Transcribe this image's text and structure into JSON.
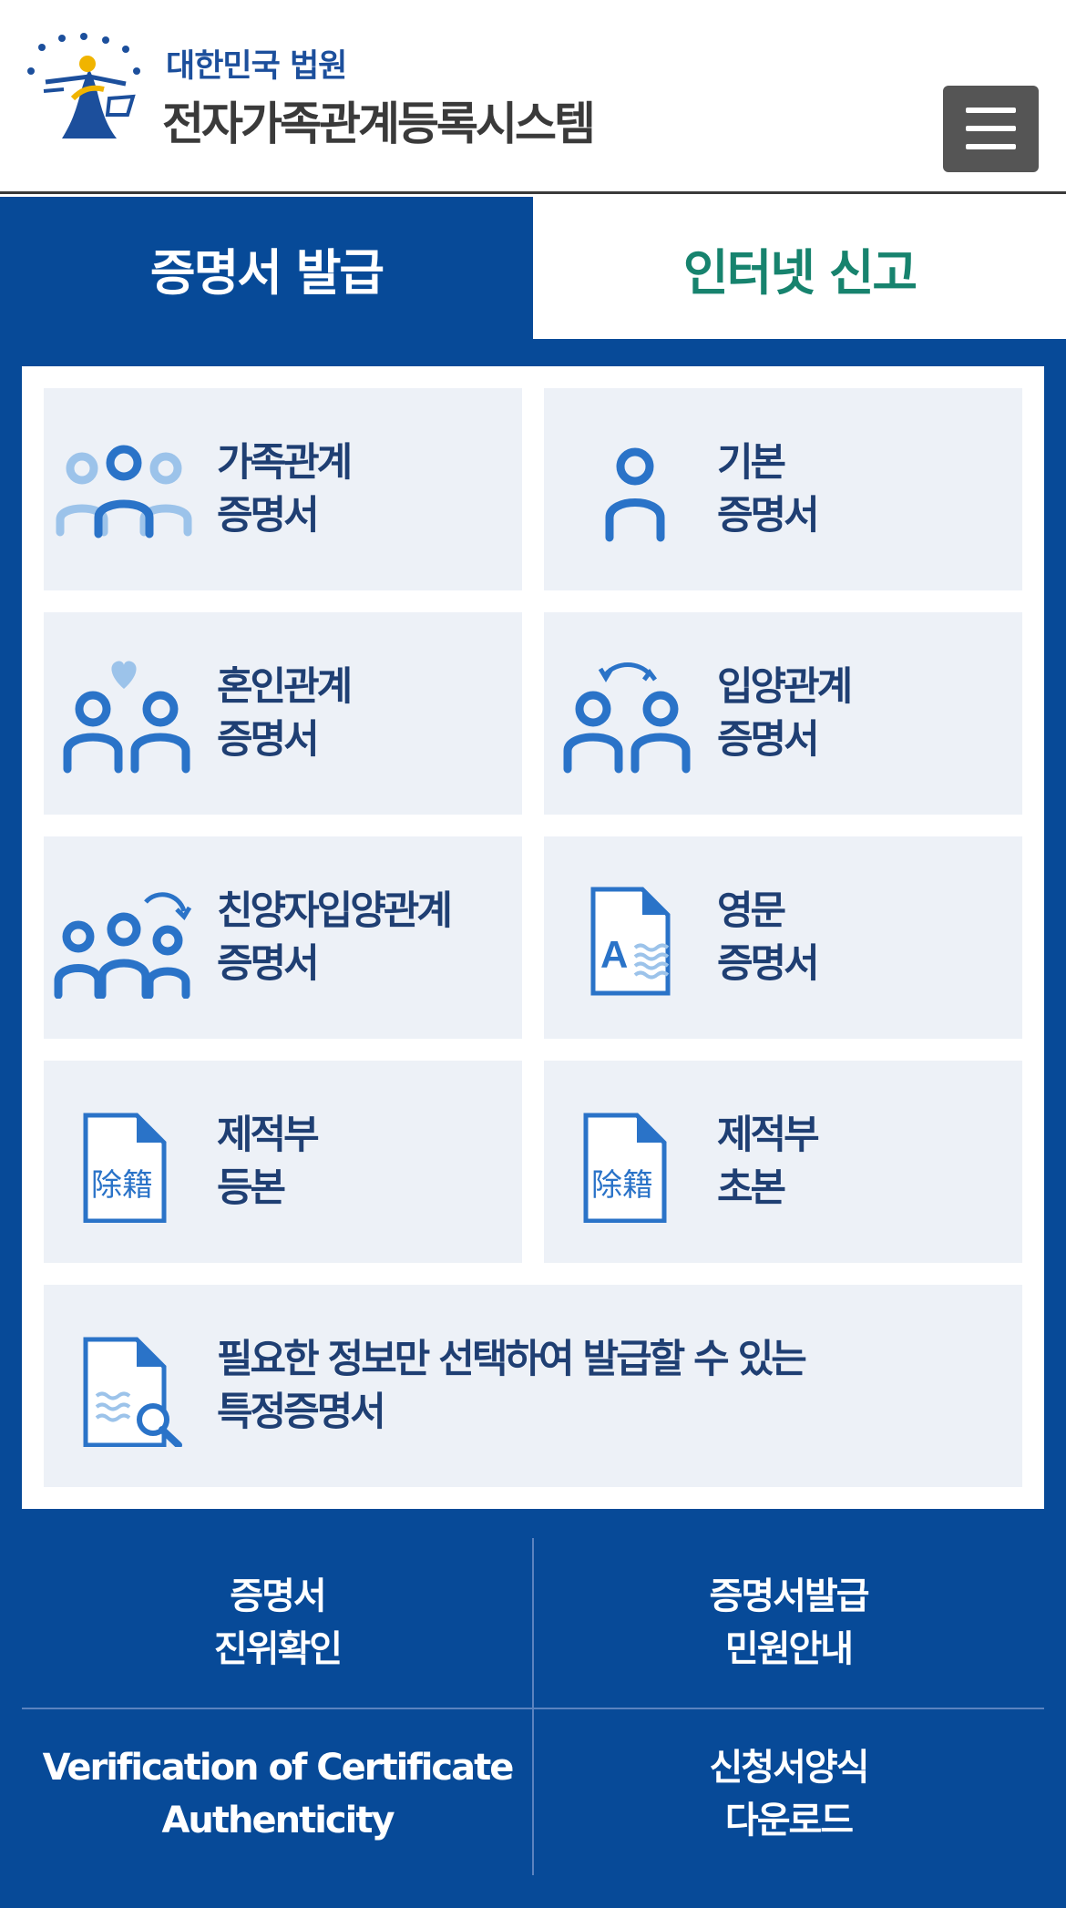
{
  "header": {
    "brand_sub": "대한민국 법원",
    "brand_main": "전자가족관계등록시스템",
    "menu_icon": "hamburger-menu-icon"
  },
  "tabs": [
    {
      "label": "증명서 발급",
      "active": true
    },
    {
      "label": "인터넷 신고",
      "active": false
    }
  ],
  "cards": [
    {
      "line1": "가족관계",
      "line2": "증명서",
      "icon": "family-group-icon"
    },
    {
      "line1": "기본",
      "line2": "증명서",
      "icon": "single-person-icon"
    },
    {
      "line1": "혼인관계",
      "line2": "증명서",
      "icon": "couple-heart-icon"
    },
    {
      "line1": "입양관계",
      "line2": "증명서",
      "icon": "adoption-swap-icon"
    },
    {
      "line1": "친양자입양관계",
      "line2": "증명서",
      "icon": "family-arrow-icon"
    },
    {
      "line1": "영문",
      "line2": "증명서",
      "icon": "english-document-icon"
    },
    {
      "line1": "제적부",
      "line2": "등본",
      "icon": "removed-register-document-icon",
      "badge": "除籍"
    },
    {
      "line1": "제적부",
      "line2": "초본",
      "icon": "removed-register-document-icon",
      "badge": "除籍"
    },
    {
      "line1": "필요한 정보만 선택하여 발급할 수 있는",
      "line2": "특정증명서",
      "icon": "document-search-icon"
    }
  ],
  "footer_links": [
    {
      "line1": "증명서",
      "line2": "진위확인"
    },
    {
      "line1": "증명서발급",
      "line2": "민원안내"
    },
    {
      "line1": "Verification of Certificate",
      "line2": "Authenticity"
    },
    {
      "line1": "신청서양식",
      "line2": "다운로드"
    }
  ],
  "colors": {
    "primary_blue": "#074a98",
    "tab_green": "#17836e",
    "card_bg": "#edf1f7",
    "icon_blue": "#2a73c8",
    "icon_light": "#9cc3ea"
  }
}
